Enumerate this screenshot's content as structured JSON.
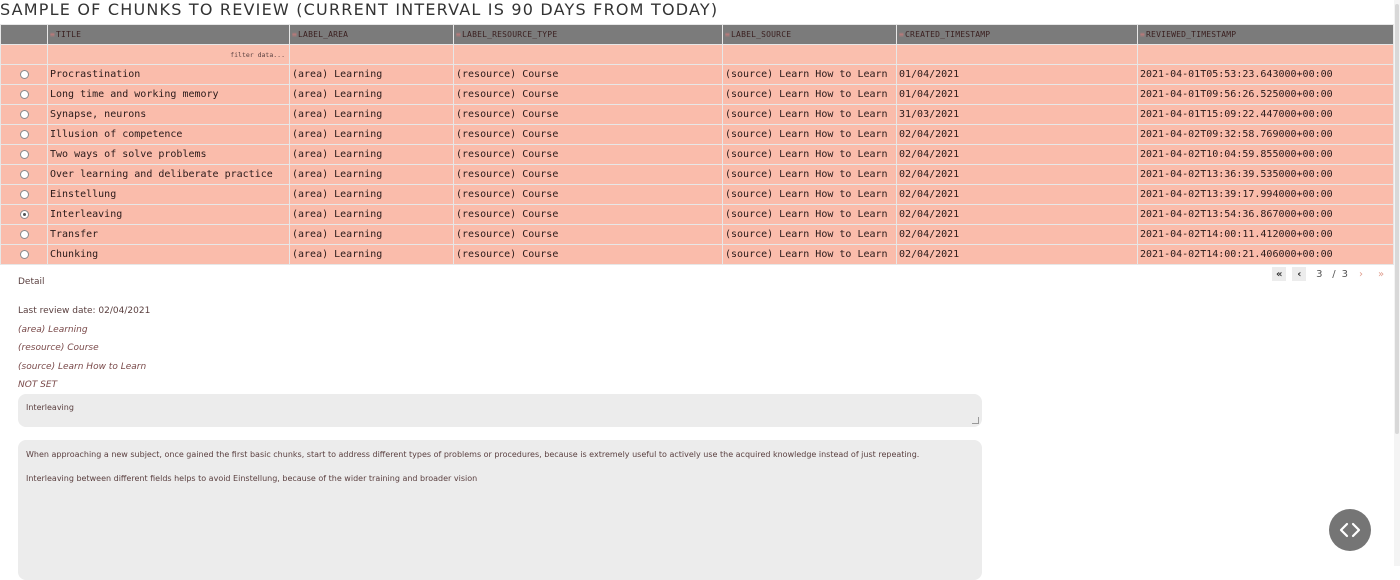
{
  "page": {
    "title": "SAMPLE OF CHUNKS TO REVIEW (CURRENT INTERVAL IS 90 DAYS FROM TODAY)"
  },
  "table": {
    "columns": [
      "TITLE",
      "LABEL_AREA",
      "LABEL_RESOURCE_TYPE",
      "LABEL_SOURCE",
      "CREATED_TIMESTAMP",
      "REVIEWED_TIMESTAMP"
    ],
    "filter_placeholder": "filter data...",
    "rows": [
      {
        "selected": false,
        "title": "Procrastination",
        "area": "(area) Learning",
        "resource": "(resource) Course",
        "source": "(source) Learn How to Learn",
        "created": "01/04/2021",
        "reviewed": "2021-04-01T05:53:23.643000+00:00"
      },
      {
        "selected": false,
        "title": "Long time and working memory",
        "area": "(area) Learning",
        "resource": "(resource) Course",
        "source": "(source) Learn How to Learn",
        "created": "01/04/2021",
        "reviewed": "2021-04-01T09:56:26.525000+00:00"
      },
      {
        "selected": false,
        "title": "Synapse, neurons",
        "area": "(area) Learning",
        "resource": "(resource) Course",
        "source": "(source) Learn How to Learn",
        "created": "31/03/2021",
        "reviewed": "2021-04-01T15:09:22.447000+00:00"
      },
      {
        "selected": false,
        "title": "Illusion of competence",
        "area": "(area) Learning",
        "resource": "(resource) Course",
        "source": "(source) Learn How to Learn",
        "created": "02/04/2021",
        "reviewed": "2021-04-02T09:32:58.769000+00:00"
      },
      {
        "selected": false,
        "title": "Two ways of solve problems",
        "area": "(area) Learning",
        "resource": "(resource) Course",
        "source": "(source) Learn How to Learn",
        "created": "02/04/2021",
        "reviewed": "2021-04-02T10:04:59.855000+00:00"
      },
      {
        "selected": false,
        "title": "Over learning and deliberate practice",
        "area": "(area) Learning",
        "resource": "(resource) Course",
        "source": "(source) Learn How to Learn",
        "created": "02/04/2021",
        "reviewed": "2021-04-02T13:36:39.535000+00:00"
      },
      {
        "selected": false,
        "title": "Einstellung",
        "area": "(area) Learning",
        "resource": "(resource) Course",
        "source": "(source) Learn How to Learn",
        "created": "02/04/2021",
        "reviewed": "2021-04-02T13:39:17.994000+00:00"
      },
      {
        "selected": true,
        "title": "Interleaving",
        "area": "(area) Learning",
        "resource": "(resource) Course",
        "source": "(source) Learn How to Learn",
        "created": "02/04/2021",
        "reviewed": "2021-04-02T13:54:36.867000+00:00"
      },
      {
        "selected": false,
        "title": "Transfer",
        "area": "(area) Learning",
        "resource": "(resource) Course",
        "source": "(source) Learn How to Learn",
        "created": "02/04/2021",
        "reviewed": "2021-04-02T14:00:11.412000+00:00"
      },
      {
        "selected": false,
        "title": "Chunking",
        "area": "(area) Learning",
        "resource": "(resource) Course",
        "source": "(source) Learn How to Learn",
        "created": "02/04/2021",
        "reviewed": "2021-04-02T14:00:21.406000+00:00"
      }
    ]
  },
  "pagination": {
    "first_icon": "double-chevron-left-icon",
    "prev_icon": "chevron-left-icon",
    "current": "3",
    "separator": "/",
    "total": "3",
    "next_icon": "chevron-right-icon",
    "last_icon": "double-chevron-right-icon"
  },
  "detail": {
    "label": "Detail",
    "last_review": "Last review date: 02/04/2021",
    "area": "(area) Learning",
    "resource": "(resource) Course",
    "source": "(source) Learn How to Learn",
    "status": "NOT SET",
    "title_value": "Interleaving",
    "body_paragraphs": [
      "When approaching a new subject, once gained the first basic chunks, start to address different types of problems or procedures, because is extremely useful to actively use the acquired knowledge instead of just repeating.",
      "Interleaving between different fields helps to avoid Einstellung, because of the  wider training and broader vision"
    ]
  },
  "colors": {
    "row_bg": "#fabcab",
    "header_bg": "#7b7b7b",
    "input_bg": "#ececec"
  },
  "code_toggle_icon": "code-brackets-icon"
}
